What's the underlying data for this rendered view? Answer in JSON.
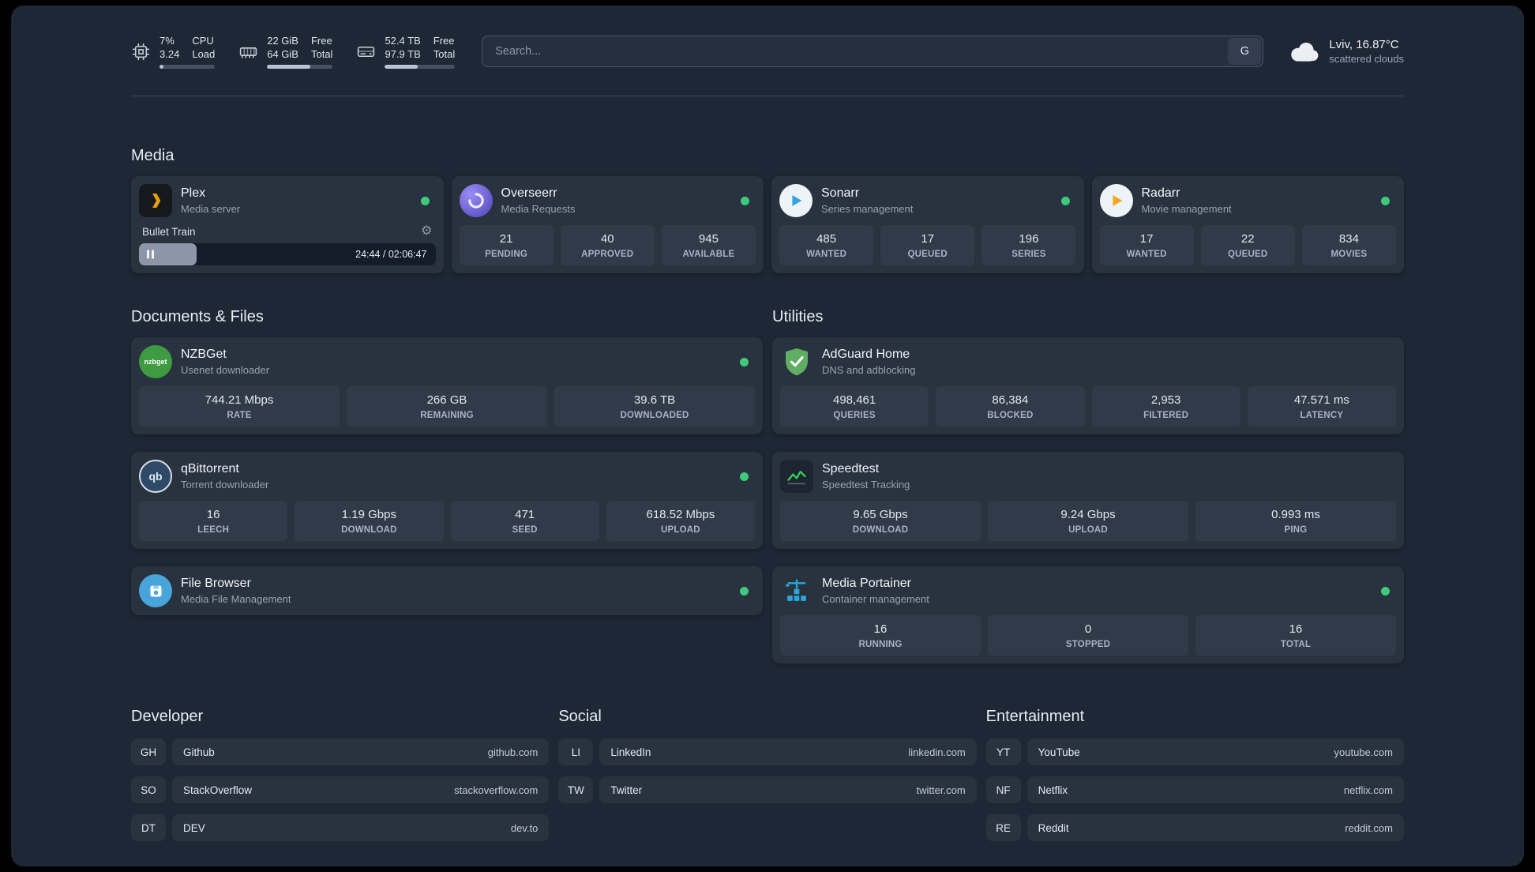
{
  "colors": {
    "status_green": "#3fc97c",
    "accent_plex": "#e5a00d",
    "accent_overseerr": "#5143b8",
    "accent_sonarr": "#35a3e0",
    "accent_radarr": "#f5a623",
    "accent_nzbget": "#3e9b41",
    "accent_filebrowser": "#4aa4dc",
    "accent_adguard": "#5fae63",
    "accent_speedtest": "#34d058",
    "accent_portainer": "#2aa7d4"
  },
  "topbar": {
    "resources": [
      {
        "v1": "7%",
        "v2": "3.24",
        "l1": "CPU",
        "l2": "Load",
        "pct": 7
      },
      {
        "v1": "22 GiB",
        "v2": "64 GiB",
        "l1": "Free",
        "l2": "Total",
        "pct": 66
      },
      {
        "v1": "52.4 TB",
        "v2": "97.9 TB",
        "l1": "Free",
        "l2": "Total",
        "pct": 47
      }
    ],
    "search_placeholder": "Search...",
    "search_engine": "G",
    "weather_line1": "Lviv, 16.87°C",
    "weather_line2": "scattered clouds"
  },
  "media": {
    "title": "Media",
    "plex": {
      "name": "Plex",
      "sub": "Media server",
      "now_playing": "Bullet Train",
      "time": "24:44 / 02:06:47",
      "progress_pct": 19.5
    },
    "overseerr": {
      "name": "Overseerr",
      "sub": "Media Requests",
      "stats": [
        {
          "v": "21",
          "l": "PENDING"
        },
        {
          "v": "40",
          "l": "APPROVED"
        },
        {
          "v": "945",
          "l": "AVAILABLE"
        }
      ]
    },
    "sonarr": {
      "name": "Sonarr",
      "sub": "Series management",
      "stats": [
        {
          "v": "485",
          "l": "WANTED"
        },
        {
          "v": "17",
          "l": "QUEUED"
        },
        {
          "v": "196",
          "l": "SERIES"
        }
      ]
    },
    "radarr": {
      "name": "Radarr",
      "sub": "Movie management",
      "stats": [
        {
          "v": "17",
          "l": "WANTED"
        },
        {
          "v": "22",
          "l": "QUEUED"
        },
        {
          "v": "834",
          "l": "MOVIES"
        }
      ]
    }
  },
  "documents": {
    "title": "Documents & Files",
    "nzbget": {
      "name": "NZBGet",
      "sub": "Usenet downloader",
      "icon_text": "nzbget",
      "stats": [
        {
          "v": "744.21 Mbps",
          "l": "RATE"
        },
        {
          "v": "266 GB",
          "l": "REMAINING"
        },
        {
          "v": "39.6 TB",
          "l": "DOWNLOADED"
        }
      ]
    },
    "qbittorrent": {
      "name": "qBittorrent",
      "sub": "Torrent downloader",
      "icon_text": "qb",
      "stats": [
        {
          "v": "16",
          "l": "LEECH"
        },
        {
          "v": "1.19 Gbps",
          "l": "DOWNLOAD"
        },
        {
          "v": "471",
          "l": "SEED"
        },
        {
          "v": "618.52 Mbps",
          "l": "UPLOAD"
        }
      ]
    },
    "filebrowser": {
      "name": "File Browser",
      "sub": "Media File Management"
    }
  },
  "utilities": {
    "title": "Utilities",
    "adguard": {
      "name": "AdGuard Home",
      "sub": "DNS and adblocking",
      "stats": [
        {
          "v": "498,461",
          "l": "QUERIES"
        },
        {
          "v": "86,384",
          "l": "BLOCKED"
        },
        {
          "v": "2,953",
          "l": "FILTERED"
        },
        {
          "v": "47.571 ms",
          "l": "LATENCY"
        }
      ]
    },
    "speedtest": {
      "name": "Speedtest",
      "sub": "Speedtest Tracking",
      "stats": [
        {
          "v": "9.65 Gbps",
          "l": "DOWNLOAD"
        },
        {
          "v": "9.24 Gbps",
          "l": "UPLOAD"
        },
        {
          "v": "0.993 ms",
          "l": "PING"
        }
      ]
    },
    "portainer": {
      "name": "Media Portainer",
      "sub": "Container management",
      "stats": [
        {
          "v": "16",
          "l": "RUNNING"
        },
        {
          "v": "0",
          "l": "STOPPED"
        },
        {
          "v": "16",
          "l": "TOTAL"
        }
      ]
    }
  },
  "bookmarks": {
    "developer": {
      "title": "Developer",
      "items": [
        {
          "abbr": "GH",
          "name": "Github",
          "domain": "github.com"
        },
        {
          "abbr": "SO",
          "name": "StackOverflow",
          "domain": "stackoverflow.com"
        },
        {
          "abbr": "DT",
          "name": "DEV",
          "domain": "dev.to"
        }
      ]
    },
    "social": {
      "title": "Social",
      "items": [
        {
          "abbr": "LI",
          "name": "LinkedIn",
          "domain": "linkedin.com"
        },
        {
          "abbr": "TW",
          "name": "Twitter",
          "domain": "twitter.com"
        }
      ]
    },
    "entertainment": {
      "title": "Entertainment",
      "items": [
        {
          "abbr": "YT",
          "name": "YouTube",
          "domain": "youtube.com"
        },
        {
          "abbr": "NF",
          "name": "Netflix",
          "domain": "netflix.com"
        },
        {
          "abbr": "RE",
          "name": "Reddit",
          "domain": "reddit.com"
        }
      ]
    }
  }
}
